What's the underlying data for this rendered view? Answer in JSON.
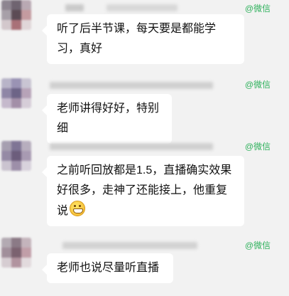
{
  "chat": {
    "source_label": "@微信",
    "messages": [
      {
        "text": "听了后半节课，每天要是都能学习，真好"
      },
      {
        "text": "老师讲得好好，特别细"
      },
      {
        "text": "之前听回放都是1.5，直播确实效果好很多，走神了还能接上，他重复说",
        "emoji": "grinning-face-emoji"
      },
      {
        "text": "老师也说尽量听直播"
      }
    ]
  }
}
